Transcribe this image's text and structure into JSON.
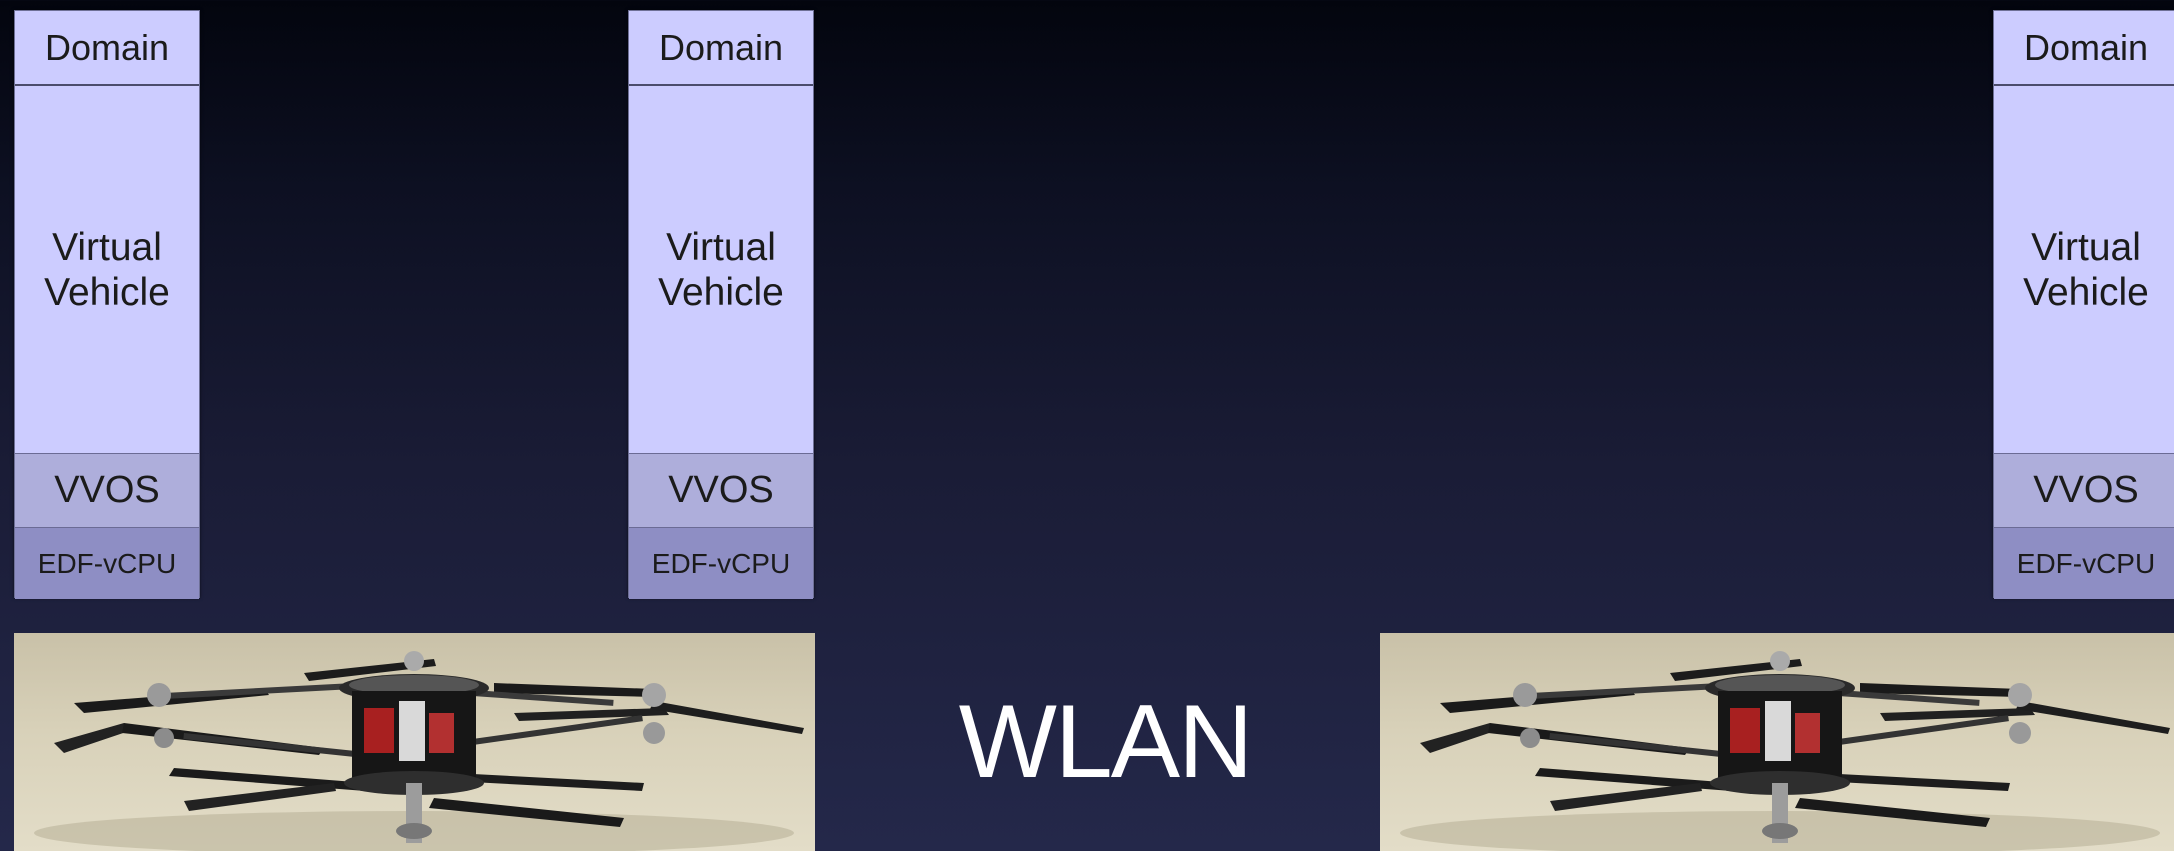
{
  "stacks": [
    {
      "domain": "Domain",
      "virtual_vehicle_line1": "Virtual",
      "virtual_vehicle_line2": "Vehicle",
      "vvos": "VVOS",
      "edf_vcpu": "EDF-vCPU"
    },
    {
      "domain": "Domain",
      "virtual_vehicle_line1": "Virtual",
      "virtual_vehicle_line2": "Vehicle",
      "vvos": "VVOS",
      "edf_vcpu": "EDF-vCPU"
    },
    {
      "domain": "Domain",
      "virtual_vehicle_line1": "Virtual",
      "virtual_vehicle_line2": "Vehicle",
      "vvos": "VVOS",
      "edf_vcpu": "EDF-vCPU"
    }
  ],
  "network_label": "WLAN",
  "photos": [
    {
      "icon": "quadrotor-helicopter-image"
    },
    {
      "icon": "quadrotor-helicopter-image"
    }
  ],
  "colors": {
    "layer_light": "#ccccff",
    "layer_vvos": "#aeaedb",
    "layer_edf": "#8e8ec4",
    "text": "#1b1b1b",
    "background_top": "#03050e",
    "background_bottom": "#24284a",
    "wlan_text": "#ffffff"
  }
}
